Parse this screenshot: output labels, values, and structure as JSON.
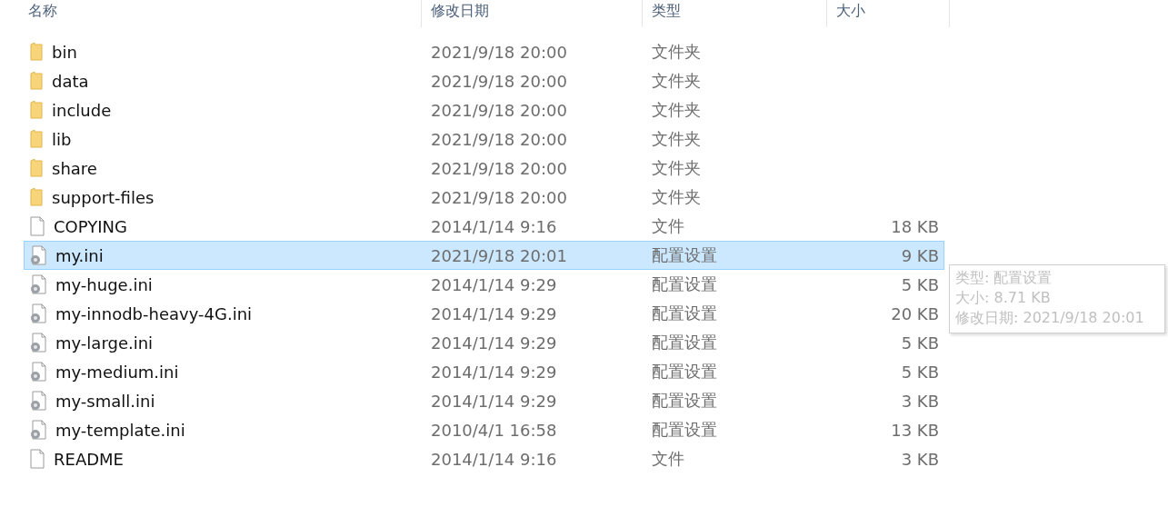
{
  "columns": [
    "名称",
    "修改日期",
    "类型",
    "大小"
  ],
  "rows": [
    {
      "kind": "folder",
      "name": "bin",
      "date": "2021/9/18 20:00",
      "type": "文件夹",
      "selected": false
    },
    {
      "kind": "folder",
      "name": "data",
      "date": "2021/9/18 20:00",
      "type": "文件夹",
      "selected": false
    },
    {
      "kind": "folder",
      "name": "include",
      "date": "2021/9/18 20:00",
      "type": "文件夹",
      "selected": false
    },
    {
      "kind": "folder",
      "name": "lib",
      "date": "2021/9/18 20:00",
      "type": "文件夹",
      "selected": false
    },
    {
      "kind": "folder",
      "name": "share",
      "date": "2021/9/18 20:00",
      "type": "文件夹",
      "selected": false
    },
    {
      "kind": "folder",
      "name": "support-files",
      "date": "2021/9/18 20:00",
      "type": "文件夹",
      "selected": false
    },
    {
      "kind": "file",
      "name": "COPYING",
      "date": "2014/1/14 9:16",
      "type": "文件",
      "size": "18 KB",
      "selected": false
    },
    {
      "kind": "config",
      "name": "my.ini",
      "date": "2021/9/18 20:01",
      "type": "配置设置",
      "size": "9 KB",
      "selected": true
    },
    {
      "kind": "config",
      "name": "my-huge.ini",
      "date": "2014/1/14 9:29",
      "type": "配置设置",
      "size": "5 KB",
      "selected": false
    },
    {
      "kind": "config",
      "name": "my-innodb-heavy-4G.ini",
      "date": "2014/1/14 9:29",
      "type": "配置设置",
      "size": "20 KB",
      "selected": false
    },
    {
      "kind": "config",
      "name": "my-large.ini",
      "date": "2014/1/14 9:29",
      "type": "配置设置",
      "size": "5 KB",
      "selected": false
    },
    {
      "kind": "config",
      "name": "my-medium.ini",
      "date": "2014/1/14 9:29",
      "type": "配置设置",
      "size": "5 KB",
      "selected": false
    },
    {
      "kind": "config",
      "name": "my-small.ini",
      "date": "2014/1/14 9:29",
      "type": "配置设置",
      "size": "3 KB",
      "selected": false
    },
    {
      "kind": "config",
      "name": "my-template.ini",
      "date": "2010/4/1 16:58",
      "type": "配置设置",
      "size": "13 KB",
      "selected": false
    },
    {
      "kind": "file",
      "name": "README",
      "date": "2014/1/14 9:16",
      "type": "文件",
      "size": "3 KB",
      "selected": false
    }
  ],
  "tooltip": [
    "类型: 配置设置",
    "大小: 8.71 KB",
    "修改日期: 2021/9/18 20:01"
  ]
}
